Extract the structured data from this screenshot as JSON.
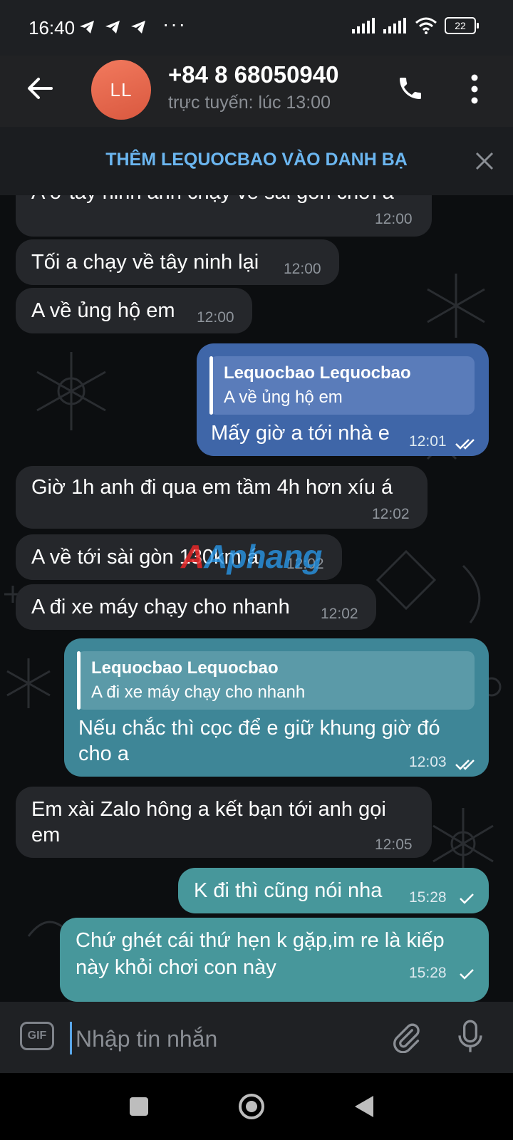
{
  "status_bar": {
    "time": "16:40",
    "dots": "···",
    "battery": "22"
  },
  "header": {
    "avatar_initials": "LL",
    "name": "+84 8 68050940",
    "status": "trực tuyến: lúc 13:00"
  },
  "banner": {
    "text": "THÊM LEQUOCBAO VÀO DANH BẠ"
  },
  "messages": [
    {
      "dir": "in",
      "text": "A ở tây ninh anh chạy về sài gòn chơi á",
      "time": "12:00"
    },
    {
      "dir": "in",
      "text": "Tối a chạy về tây ninh lại",
      "time": "12:00"
    },
    {
      "dir": "in",
      "text": "A về ủng hộ em",
      "time": "12:00"
    },
    {
      "dir": "out",
      "reply_name": "Lequocbao Lequocbao",
      "reply_text": "A về ủng hộ em",
      "text": "Mấy giờ a tới nhà e",
      "time": "12:01",
      "read": "double"
    },
    {
      "dir": "in",
      "text": "Giờ 1h anh đi qua em tầm 4h hơn xíu á",
      "time": "12:02"
    },
    {
      "dir": "in",
      "text": "A về tới sài gòn 130km á",
      "time": "12:02"
    },
    {
      "dir": "in",
      "text": "A đi xe máy chạy cho nhanh",
      "time": "12:02"
    },
    {
      "dir": "out",
      "reply_name": "Lequocbao Lequocbao",
      "reply_text": "A đi xe máy chạy cho nhanh",
      "text_lines": [
        "Nếu chắc thì cọc để e giữ khung giờ đó",
        "cho a"
      ],
      "time": "12:03",
      "read": "double"
    },
    {
      "dir": "in",
      "text_lines": [
        "Em xài Zalo hông a kết bạn tới anh gọi",
        "em"
      ],
      "time": "12:05"
    },
    {
      "dir": "out",
      "text": "K đi thì cũng nói nha",
      "time": "15:28",
      "read": "single"
    },
    {
      "dir": "out",
      "text_lines": [
        "Chứ ghét cái thứ hẹn k gặp,im re là kiếp",
        "này khỏi chơi con này"
      ],
      "time": "15:28",
      "read": "single"
    }
  ],
  "watermark": {
    "text": "Aphang"
  },
  "input_bar": {
    "gif_label": "GIF",
    "placeholder": "Nhập tin nhắn"
  },
  "icons": {
    "telegram": "telegram-plane-icon",
    "signal": "signal-bars-icon",
    "wifi": "wifi-icon",
    "battery": "battery-icon",
    "back": "arrow-left-icon",
    "call": "phone-icon",
    "menu": "more-vertical-icon",
    "close": "close-icon",
    "read_double": "double-check-icon",
    "read_single": "check-icon",
    "attach": "paperclip-icon",
    "mic": "microphone-icon",
    "nav": [
      "square-recents-icon",
      "circle-home-icon",
      "triangle-back-icon"
    ]
  },
  "colors": {
    "accent_link": "#6bb6f0",
    "avatar": "#e26a4f",
    "incoming": "#25272b",
    "outgoing_blue": "#3f66a8",
    "outgoing_teal": "#3e8697",
    "header": "#212224"
  }
}
